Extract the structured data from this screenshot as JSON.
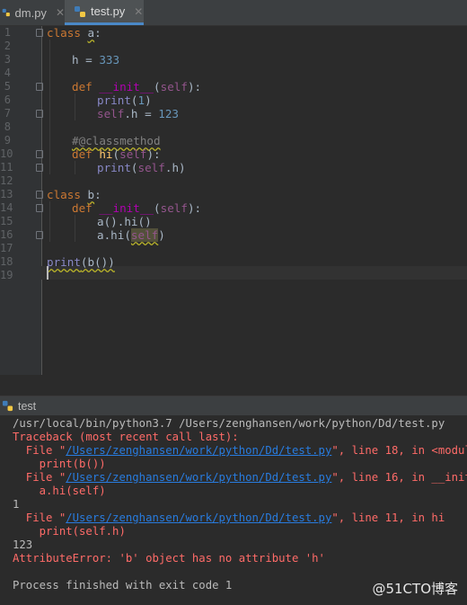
{
  "tabs": [
    {
      "label": "dm.py",
      "close": "✕"
    },
    {
      "label": "test.py",
      "close": "✕"
    }
  ],
  "editor": {
    "line_numbers": [
      "1",
      "2",
      "3",
      "4",
      "5",
      "6",
      "7",
      "8",
      "9",
      "10",
      "11",
      "12",
      "13",
      "14",
      "15",
      "16",
      "17",
      "18",
      "19"
    ],
    "code": {
      "l1": {
        "kw": "class",
        "name": "a",
        "rest": ":"
      },
      "l3": {
        "var": "h = ",
        "num": "333"
      },
      "l5": {
        "kw": "def",
        "name": "__init__",
        "open": "(",
        "self": "self",
        "close": "):"
      },
      "l6": {
        "bi": "print",
        "open": "(",
        "num": "1",
        "close": ")"
      },
      "l7": {
        "self": "self",
        "mid": ".h = ",
        "num": "123"
      },
      "l9": {
        "comment": "#@classmethod"
      },
      "l10": {
        "kw": "def",
        "name": "hi",
        "open": "(",
        "self": "self",
        "close": "):"
      },
      "l11": {
        "bi": "print",
        "open": "(",
        "self": "self",
        "close": ".h)"
      },
      "l13": {
        "kw": "class",
        "name": "b",
        "rest": ":"
      },
      "l14": {
        "kw": "def",
        "name": "__init__",
        "open": "(",
        "self": "self",
        "close": "):"
      },
      "l15": {
        "text": "a().hi()"
      },
      "l16": {
        "pre": "a.hi(",
        "self": "self",
        "close": ")"
      },
      "l18": {
        "bi": "print",
        "rest": "(b())"
      }
    }
  },
  "run": {
    "title": "test",
    "console": {
      "cmd": "/usr/local/bin/python3.7 /Users/zenghansen/work/python/Dd/test.py",
      "traceback": "Traceback (most recent call last):",
      "frames": [
        {
          "pre": "  File \"",
          "path": "/Users/zenghansen/work/python/Dd/test.py",
          "post": "\", line 18, in <module>",
          "code": "    print(b())"
        },
        {
          "pre": "  File \"",
          "path": "/Users/zenghansen/work/python/Dd/test.py",
          "post": "\", line 16, in __init__",
          "code": "    a.hi(self)"
        },
        {
          "pre": "  File \"",
          "path": "/Users/zenghansen/work/python/Dd/test.py",
          "post": "\", line 11, in hi",
          "code": "    print(self.h)"
        }
      ],
      "out1": "1",
      "out2": "123",
      "error": "AttributeError: 'b' object has no attribute 'h'",
      "exit": "Process finished with exit code 1"
    }
  },
  "watermark": "@51CTO博客"
}
